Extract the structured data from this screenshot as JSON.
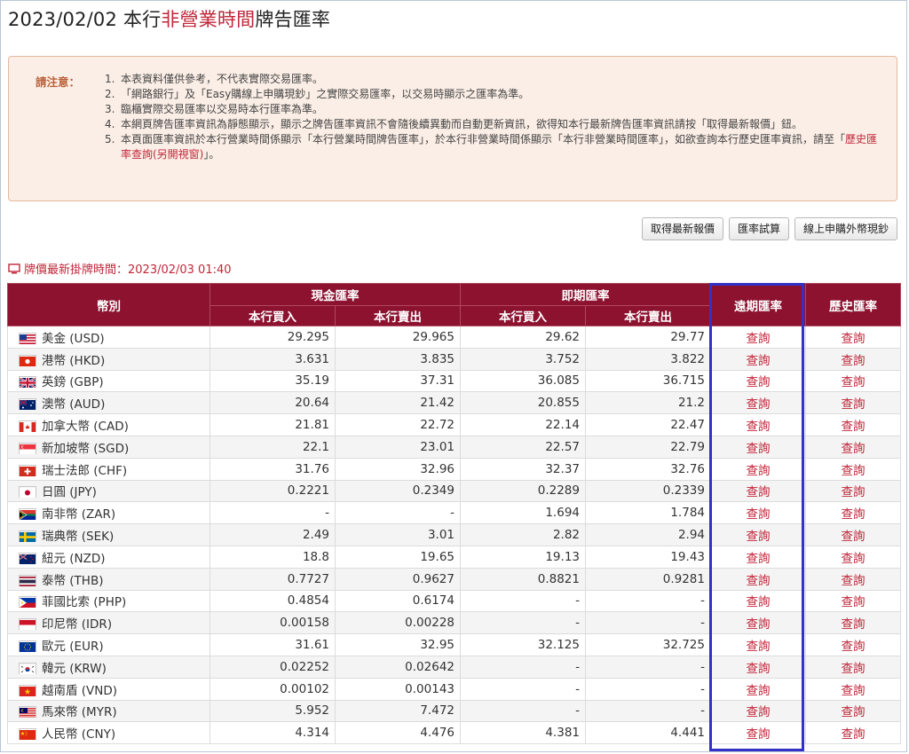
{
  "title": {
    "pre": "2023/02/02 本行",
    "highlight": "非營業時間",
    "post": "牌告匯率"
  },
  "notice": {
    "label": "請注意：",
    "items": [
      {
        "num": "1.",
        "text": "本表資料僅供參考，不代表實際交易匯率。"
      },
      {
        "num": "2.",
        "text": "「網路銀行」及「Easy購線上申購現鈔」之實際交易匯率，以交易時顯示之匯率為準。"
      },
      {
        "num": "3.",
        "text": "臨櫃實際交易匯率以交易時本行匯率為準。"
      },
      {
        "num": "4.",
        "text": "本網頁牌告匯率資訊為靜態顯示，顯示之牌告匯率資訊不會隨後續異動而自動更新資訊，欲得知本行最新牌告匯率資訊請按「取得最新報價」鈕。"
      },
      {
        "num": "5.",
        "text_pre": "本頁面匯率資訊於本行營業時間係顯示「本行營業時間牌告匯率」，於本行非營業時間係顯示「本行非營業時間匯率」，如欲查詢本行歷史匯率資訊，請至「",
        "link": "歷史匯率查詢(另開視窗)",
        "text_post": "」。"
      }
    ]
  },
  "buttons": {
    "refresh": "取得最新報價",
    "calc": "匯率試算",
    "buy_cash": "線上申購外幣現鈔"
  },
  "posted_time": "牌價最新掛牌時間：2023/02/03 01:40",
  "table": {
    "h_currency": "幣別",
    "h_cash": "現金匯率",
    "h_spot": "即期匯率",
    "h_forward": "遠期匯率",
    "h_history": "歷史匯率",
    "h_buy": "本行買入",
    "h_sell": "本行賣出",
    "query": "查詢",
    "rows": [
      {
        "currency": "美金 (USD)",
        "flag": "US",
        "cash_buy": "29.295",
        "cash_sell": "29.965",
        "spot_buy": "29.62",
        "spot_sell": "29.77"
      },
      {
        "currency": "港幣 (HKD)",
        "flag": "HK",
        "cash_buy": "3.631",
        "cash_sell": "3.835",
        "spot_buy": "3.752",
        "spot_sell": "3.822"
      },
      {
        "currency": "英鎊 (GBP)",
        "flag": "GB",
        "cash_buy": "35.19",
        "cash_sell": "37.31",
        "spot_buy": "36.085",
        "spot_sell": "36.715"
      },
      {
        "currency": "澳幣 (AUD)",
        "flag": "AU",
        "cash_buy": "20.64",
        "cash_sell": "21.42",
        "spot_buy": "20.855",
        "spot_sell": "21.2"
      },
      {
        "currency": "加拿大幣 (CAD)",
        "flag": "CA",
        "cash_buy": "21.81",
        "cash_sell": "22.72",
        "spot_buy": "22.14",
        "spot_sell": "22.47"
      },
      {
        "currency": "新加坡幣 (SGD)",
        "flag": "SG",
        "cash_buy": "22.1",
        "cash_sell": "23.01",
        "spot_buy": "22.57",
        "spot_sell": "22.79"
      },
      {
        "currency": "瑞士法郎 (CHF)",
        "flag": "CH",
        "cash_buy": "31.76",
        "cash_sell": "32.96",
        "spot_buy": "32.37",
        "spot_sell": "32.76"
      },
      {
        "currency": "日圓 (JPY)",
        "flag": "JP",
        "cash_buy": "0.2221",
        "cash_sell": "0.2349",
        "spot_buy": "0.2289",
        "spot_sell": "0.2339"
      },
      {
        "currency": "南非幣 (ZAR)",
        "flag": "ZA",
        "cash_buy": "-",
        "cash_sell": "-",
        "spot_buy": "1.694",
        "spot_sell": "1.784"
      },
      {
        "currency": "瑞典幣 (SEK)",
        "flag": "SE",
        "cash_buy": "2.49",
        "cash_sell": "3.01",
        "spot_buy": "2.82",
        "spot_sell": "2.94"
      },
      {
        "currency": "紐元 (NZD)",
        "flag": "NZ",
        "cash_buy": "18.8",
        "cash_sell": "19.65",
        "spot_buy": "19.13",
        "spot_sell": "19.43"
      },
      {
        "currency": "泰幣 (THB)",
        "flag": "TH",
        "cash_buy": "0.7727",
        "cash_sell": "0.9627",
        "spot_buy": "0.8821",
        "spot_sell": "0.9281"
      },
      {
        "currency": "菲國比索 (PHP)",
        "flag": "PH",
        "cash_buy": "0.4854",
        "cash_sell": "0.6174",
        "spot_buy": "-",
        "spot_sell": "-"
      },
      {
        "currency": "印尼幣 (IDR)",
        "flag": "ID",
        "cash_buy": "0.00158",
        "cash_sell": "0.00228",
        "spot_buy": "-",
        "spot_sell": "-"
      },
      {
        "currency": "歐元 (EUR)",
        "flag": "EU",
        "cash_buy": "31.61",
        "cash_sell": "32.95",
        "spot_buy": "32.125",
        "spot_sell": "32.725"
      },
      {
        "currency": "韓元 (KRW)",
        "flag": "KR",
        "cash_buy": "0.02252",
        "cash_sell": "0.02642",
        "spot_buy": "-",
        "spot_sell": "-"
      },
      {
        "currency": "越南盾 (VND)",
        "flag": "VN",
        "cash_buy": "0.00102",
        "cash_sell": "0.00143",
        "spot_buy": "-",
        "spot_sell": "-"
      },
      {
        "currency": "馬來幣 (MYR)",
        "flag": "MY",
        "cash_buy": "5.952",
        "cash_sell": "7.472",
        "spot_buy": "-",
        "spot_sell": "-"
      },
      {
        "currency": "人民幣 (CNY)",
        "flag": "CN",
        "cash_buy": "4.314",
        "cash_sell": "4.476",
        "spot_buy": "4.381",
        "spot_sell": "4.441"
      }
    ]
  },
  "colors": {
    "brand": "#8c1230",
    "accent_red": "#c0273a",
    "highlight_box": "#3232c8",
    "notice_bg": "#fbeee6"
  }
}
